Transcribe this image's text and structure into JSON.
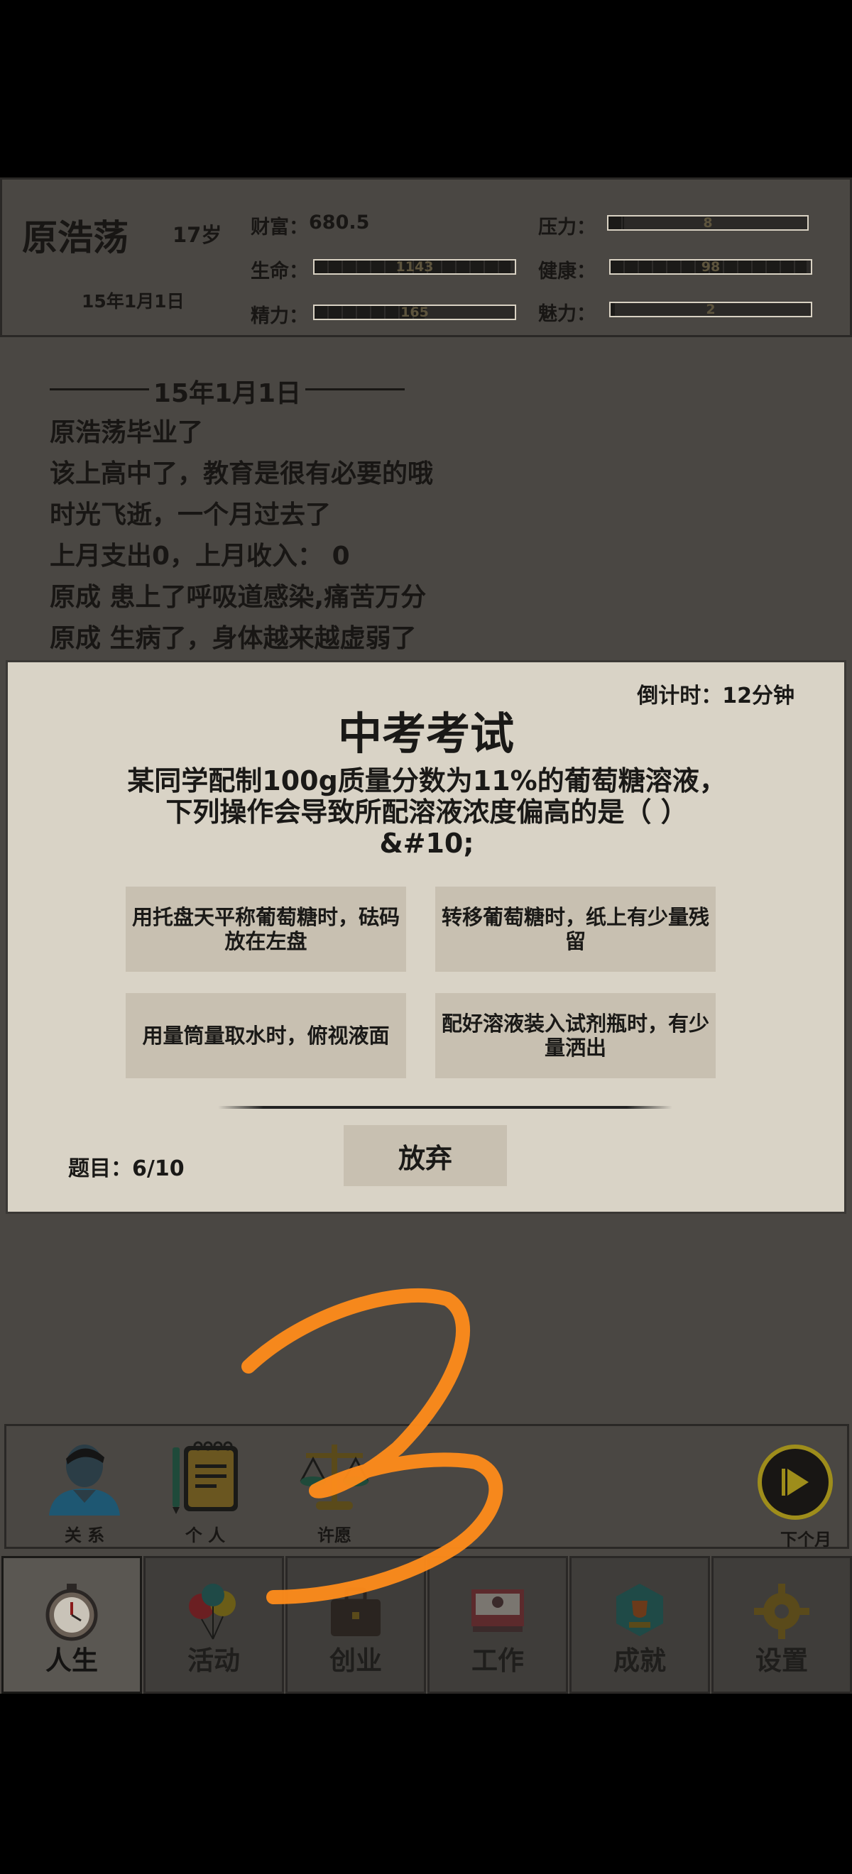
{
  "header": {
    "name": "原浩荡",
    "age": "17岁",
    "date": "15年1月1日",
    "wealth_label": "财富：",
    "wealth_value": "680.5",
    "life_label": "生命：",
    "life_value": "1143",
    "life_fraction": 0.98,
    "energy_label": "精力：",
    "energy_value": "165",
    "energy_fraction": 0.55,
    "pressure_label": "压力：",
    "pressure_value": "8",
    "pressure_fraction": 0.08,
    "health_label": "健康：",
    "health_value": "98",
    "health_fraction": 0.98,
    "charm_label": "魅力：",
    "charm_value": "2",
    "charm_fraction": 0.02
  },
  "log": {
    "date": "15年1月1日",
    "lines": [
      "原浩荡毕业了",
      "该上高中了，教育是很有必要的哦",
      "时光飞逝，一个月过去了",
      "上月支出0，上月收入： 0",
      "原成 患上了呼吸道感染,痛苦万分",
      "原成 生病了，身体越来越虚弱了"
    ]
  },
  "exam": {
    "countdown": "倒计时：12分钟",
    "title": "中考考试",
    "question": "某同学配制100g质量分数为11%的葡萄糖溶液，下列操作会导致所配溶液浓度偏高的是（ ） &#10;",
    "options": [
      "用托盘天平称葡萄糖时，砝码放在左盘",
      "转移葡萄糖时，纸上有少量残留",
      "用量筒量取水时，俯视液面",
      "配好溶液装入试剂瓶时，有少量洒出"
    ],
    "counter": "题目：6/10",
    "quit": "放弃"
  },
  "quick": {
    "relation": "关 系",
    "personal": "个 人",
    "wish": "许愿",
    "next_month": "下个月"
  },
  "tabs": [
    "人生",
    "活动",
    "创业",
    "工作",
    "成就",
    "设置"
  ],
  "colors": {
    "background": "#4a4743",
    "dialog": "#d9d3c6",
    "button": "#c8c0b1",
    "scribble": "#ff8c1a"
  }
}
